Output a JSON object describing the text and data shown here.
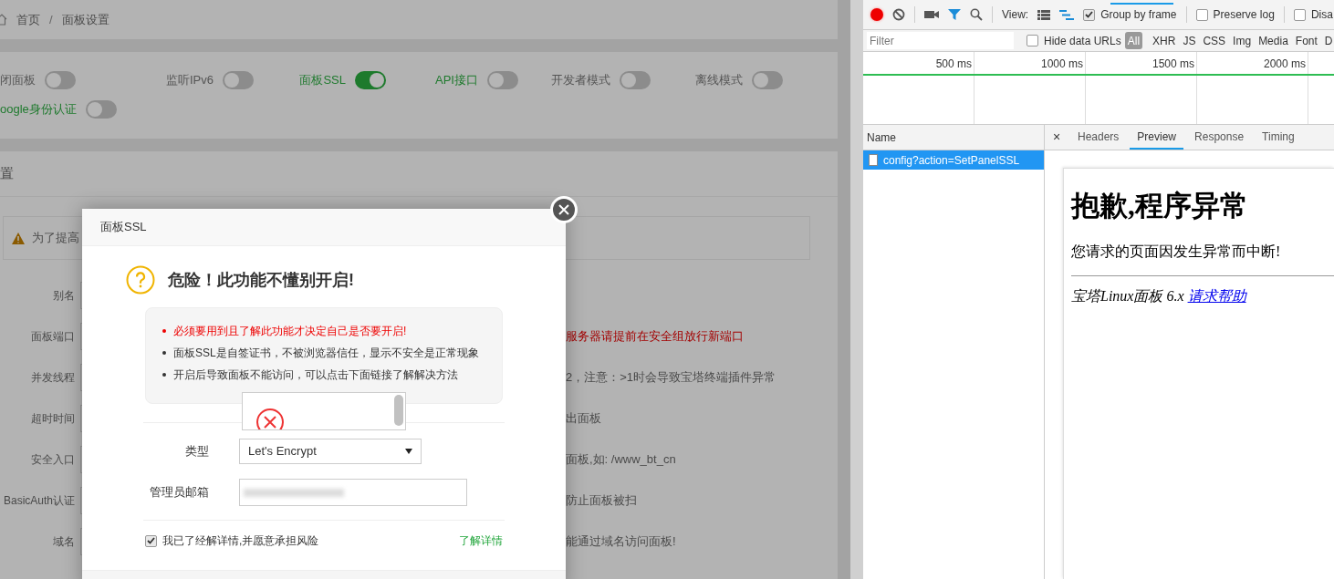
{
  "breadcrumb": {
    "items": [
      "首页",
      "面板设置"
    ],
    "separator": "/"
  },
  "toggles": [
    {
      "label": "闭面板",
      "on": false,
      "color": "#555555"
    },
    {
      "label": "监听IPv6",
      "on": false,
      "color": "#555555"
    },
    {
      "label": "面板SSL",
      "on": true,
      "color": "#1f7a2e"
    },
    {
      "label": "API接口",
      "on": false,
      "color": "#1f7a2e"
    },
    {
      "label": "开发者模式",
      "on": false,
      "color": "#555555"
    },
    {
      "label": "离线模式",
      "on": false,
      "color": "#555555"
    },
    {
      "label": "oogle身份认证",
      "on": false,
      "color": "#1f7a2e"
    }
  ],
  "settings": {
    "title": "置",
    "alert": "为了提高",
    "rows": [
      {
        "label": "别名"
      },
      {
        "label": "面板端口",
        "hint": "服务器请提前在安全组放行新端口",
        "warning": true
      },
      {
        "label": "并发线程",
        "hint": "2，注意：>1时会导致宝塔终端插件异常",
        "warning": false
      },
      {
        "label": "超时时间",
        "hint": "出面板",
        "warning": false
      },
      {
        "label": "安全入口",
        "hint": "面板,如: /www_bt_cn",
        "warning": false
      },
      {
        "label": "BasicAuth认证",
        "hint": "防止面板被扫",
        "warning": false
      },
      {
        "label": "域名",
        "hint": "能通过域名访问面板!",
        "warning": false
      }
    ]
  },
  "dialog": {
    "title": "面板SSL",
    "heading": "危险！此功能不懂别开启!",
    "notes": [
      {
        "text": "必须要用到且了解此功能才决定自己是否要开启!",
        "kind": "warning"
      },
      {
        "text": "面板SSL是自签证书，不被浏览器信任，显示不安全是正常现象",
        "kind": "normal"
      },
      {
        "text": "开启后导致面板不能访问，可以点击下面链接了解解决方法",
        "kind": "normal"
      }
    ],
    "type_label": "类型",
    "type_value": "Let's Encrypt",
    "email_label": "管理员邮箱",
    "agree": {
      "label": "我已了经解详情,并愿意承担风险",
      "checked": true
    },
    "details_link": "了解详情"
  },
  "devtools": {
    "view_label": "View:",
    "options": [
      {
        "label": "Group by frame",
        "checked": true
      },
      {
        "label": "Preserve log",
        "checked": false
      },
      {
        "label": "Disa",
        "checked": false
      }
    ],
    "filter_placeholder": "Filter",
    "hide_data_urls": {
      "label": "Hide data URLs",
      "checked": false
    },
    "types": [
      {
        "label": "All",
        "selected": true
      },
      {
        "label": "XHR",
        "selected": false
      },
      {
        "label": "JS",
        "selected": false
      },
      {
        "label": "CSS",
        "selected": false
      },
      {
        "label": "Img",
        "selected": false
      },
      {
        "label": "Media",
        "selected": false
      },
      {
        "label": "Font",
        "selected": false
      },
      {
        "label": "D",
        "selected": false
      }
    ],
    "ticks": [
      "500 ms",
      "1000 ms",
      "1500 ms",
      "2000 ms"
    ],
    "name_header": "Name",
    "requests": [
      {
        "name": "config?action=SetPanelSSL",
        "selected": true
      }
    ],
    "close": "×",
    "tabs": [
      {
        "label": "Headers",
        "selected": false
      },
      {
        "label": "Preview",
        "selected": true
      },
      {
        "label": "Response",
        "selected": false
      },
      {
        "label": "Timing",
        "selected": false
      }
    ],
    "preview": {
      "heading": "抱歉,程序异常",
      "message": "您请求的页面因发生异常而中断!",
      "footer": "宝塔Linux面板 6.x",
      "link": "请求帮助"
    }
  }
}
